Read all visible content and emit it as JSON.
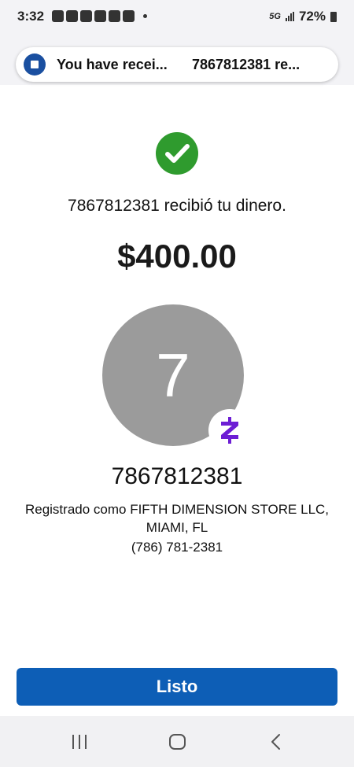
{
  "status_bar": {
    "time": "3:32",
    "network": "5G",
    "battery": "72%"
  },
  "notification": {
    "title": "You have recei...",
    "text": "7867812381 re..."
  },
  "confirmation": {
    "message": "7867812381 recibió tu dinero.",
    "amount": "$400.00"
  },
  "recipient": {
    "avatar_initial": "7",
    "name": "7867812381",
    "registered_as": "Registrado como FIFTH DIMENSION STORE LLC, MIAMI, FL",
    "phone": "(786) 781-2381"
  },
  "actions": {
    "done_label": "Listo"
  },
  "colors": {
    "success_green": "#2f9b2e",
    "button_blue": "#0d5eb6",
    "avatar_gray": "#9b9b9b",
    "zelle_purple": "#6d1ed4"
  }
}
